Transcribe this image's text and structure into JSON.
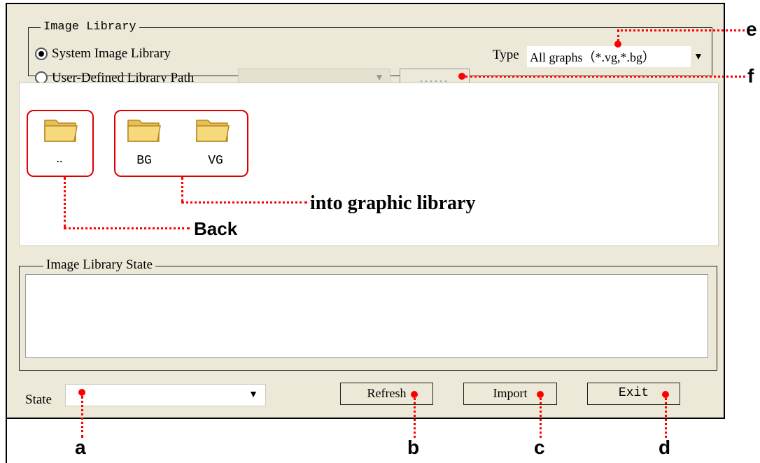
{
  "image_library": {
    "legend": "Image Library",
    "system_label": "System Image Library",
    "user_label": "User-Defined Library Path",
    "path_value": "",
    "browse_label": "......",
    "type_label": "Type",
    "type_value": "All graphs（*.vg,*.bg）"
  },
  "files": {
    "back_label": "..",
    "folder1_label": "BG",
    "folder2_label": "VG"
  },
  "state_group": {
    "legend": "Image Library State",
    "text": ""
  },
  "bottom": {
    "state_label": "State",
    "state_value": "",
    "refresh_label": "Refresh",
    "import_label": "Import",
    "exit_label": "Exit"
  },
  "annotations": {
    "a": "a",
    "b": "b",
    "c": "c",
    "d": "d",
    "e": "e",
    "f": "f",
    "back": "Back",
    "into": "into graphic library"
  },
  "colors": {
    "dialog_bg": "#ECE9D8",
    "annotation_red": "#FF0000",
    "folder_fill": "#F6D97A"
  }
}
